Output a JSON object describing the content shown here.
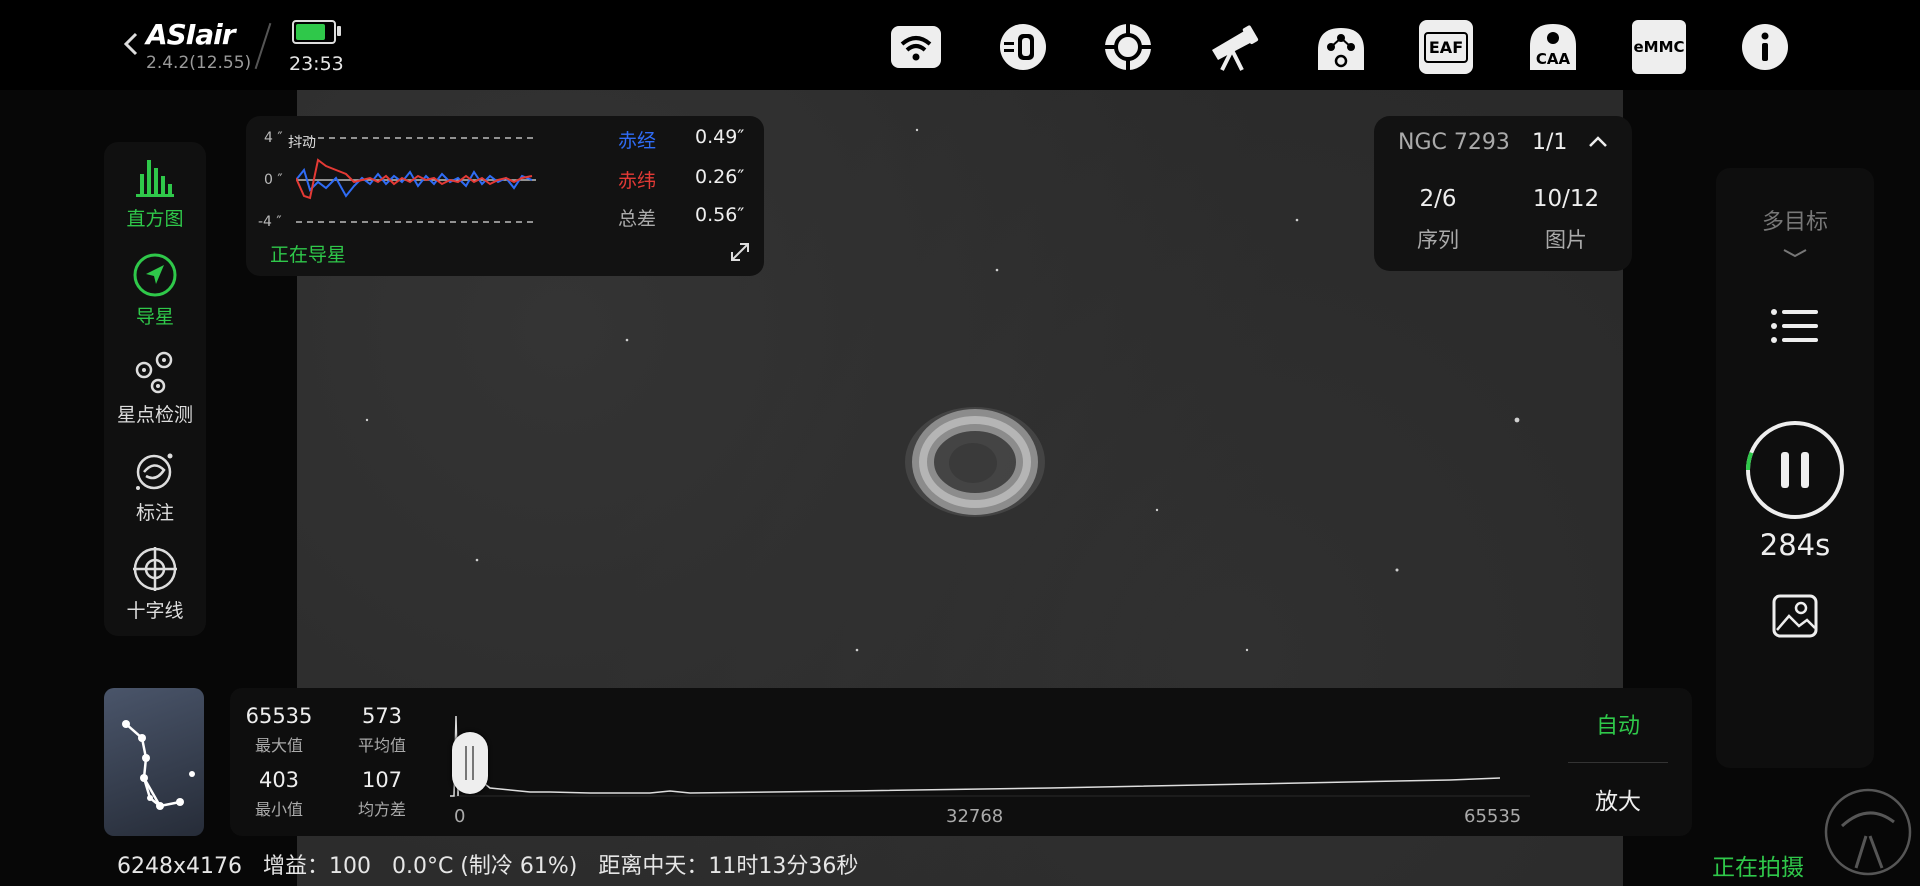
{
  "header": {
    "app_name": "ASIair",
    "version": "2.4.2(12.55)",
    "time": "23:53",
    "battery_level": 0.8,
    "eaf_label": "EAF",
    "caa_label": "CAA",
    "emmc_label": "eMMC",
    "icons": [
      "back-icon",
      "wifi-icon",
      "filter-wheel-icon",
      "guide-target-icon",
      "telescope-icon",
      "mount-icon",
      "eaf-icon",
      "caa-icon",
      "emmc-icon",
      "info-icon"
    ]
  },
  "left_tools": [
    {
      "label": "直方图",
      "icon": "histogram-icon",
      "active": true
    },
    {
      "label": "导星",
      "icon": "guide-arrow-icon",
      "active": true
    },
    {
      "label": "星点检测",
      "icon": "star-detect-icon",
      "active": false
    },
    {
      "label": "标注",
      "icon": "annotate-icon",
      "active": false
    },
    {
      "label": "十字线",
      "icon": "crosshair-icon",
      "active": false
    }
  ],
  "guide": {
    "scale_top": "4 ″",
    "scale_mid": "0 ″",
    "scale_bottom": "-4 ″",
    "dither_label": "抖动",
    "ra_label": "赤经",
    "ra_value": "0.49″",
    "dec_label": "赤纬",
    "dec_value": "0.26″",
    "total_label": "总差",
    "total_value": "0.56″",
    "status": "正在导星",
    "ra_color": "#2f6cf5",
    "dec_color": "#e43a35"
  },
  "target": {
    "name": "NGC 7293",
    "count": "1/1",
    "sequence_value": "2/6",
    "sequence_label": "序列",
    "image_value": "10/12",
    "image_label": "图片"
  },
  "right_panel": {
    "multi_target": "多目标",
    "exposure_remaining": "284s",
    "exposure_progress": 0.06
  },
  "histogram": {
    "max_value": "65535",
    "max_label": "最大值",
    "mean_value": "573",
    "mean_label": "平均值",
    "min_value": "403",
    "min_label": "最小值",
    "std_value": "107",
    "std_label": "均方差",
    "tick_0": "0",
    "tick_mid": "32768",
    "tick_max": "65535",
    "auto_label": "自动",
    "zoom_label": "放大"
  },
  "status_bar": {
    "resolution": "6248x4176",
    "gain": "增益：100",
    "temperature": "0.0°C (制冷 61%)",
    "meridian": "距离中天：11时13分36秒",
    "capturing": "正在拍摄"
  },
  "colors": {
    "accent_green": "#2fc84a",
    "panel_bg": "#121212"
  }
}
